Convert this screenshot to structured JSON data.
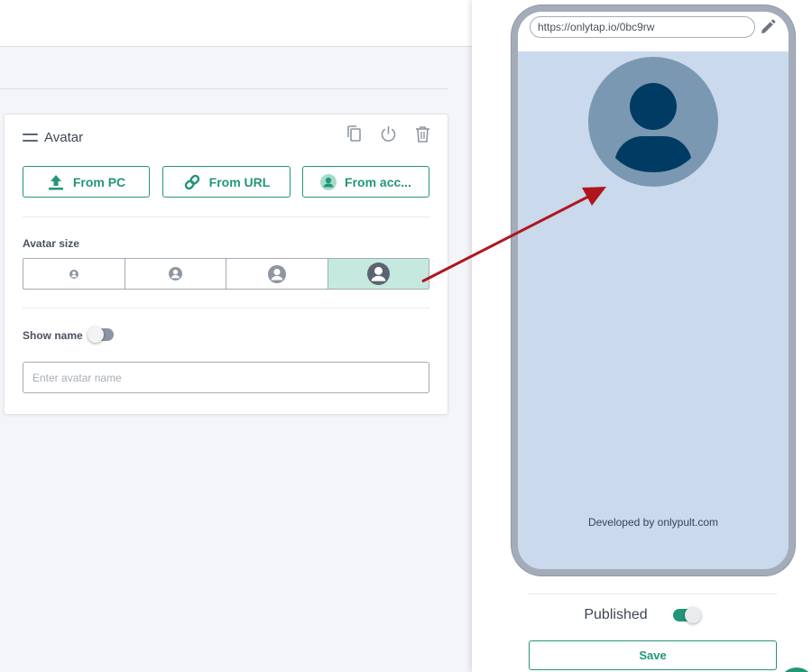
{
  "editor": {
    "card": {
      "title": "Avatar",
      "actions": [
        {
          "name": "copy-icon"
        },
        {
          "name": "power-icon"
        },
        {
          "name": "trash-icon"
        }
      ],
      "source_buttons": [
        {
          "label": "From PC",
          "icon": "upload-icon"
        },
        {
          "label": "From URL",
          "icon": "link-icon"
        },
        {
          "label": "From acc...",
          "icon": "account-avatar-icon"
        }
      ],
      "avatar_size": {
        "label": "Avatar size",
        "options": [
          "size-xs",
          "size-s",
          "size-m",
          "size-l"
        ],
        "selected_index": 3
      },
      "show_name": {
        "label": "Show name",
        "enabled": false
      },
      "name_input": {
        "value": "",
        "placeholder": "Enter avatar name"
      }
    }
  },
  "preview": {
    "url": "https://onlytap.io/0bc9rw",
    "footer_credit": "Developed by onlypult.com",
    "published_label": "Published",
    "published": true,
    "save_label": "Save"
  },
  "colors": {
    "accent": "#229678",
    "selected_bg": "#c6e9df",
    "phone_bg": "#cad9ec",
    "avatar_circle": "#7b98b2",
    "avatar_figure": "#003b63",
    "arrow": "#b0151e"
  }
}
